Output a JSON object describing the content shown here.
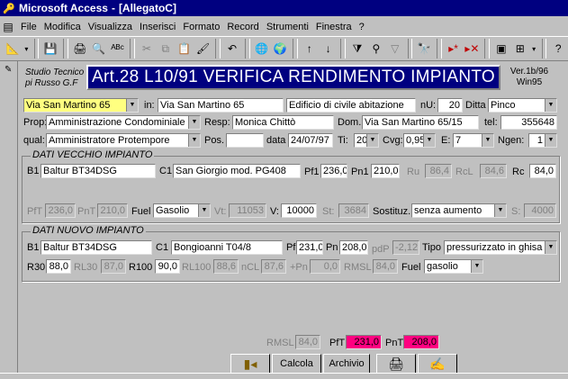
{
  "title": {
    "app": "Microsoft Access",
    "doc": "[AllegatoC]"
  },
  "menu": [
    "File",
    "Modifica",
    "Visualizza",
    "Inserisci",
    "Formato",
    "Record",
    "Strumenti",
    "Finestra",
    "?"
  ],
  "header": {
    "studio": "Studio Tecnico pi Russo G.F",
    "title": "Art.28 L10/91 VERIFICA RENDIMENTO IMPIANTO",
    "ver1": "Ver.1b/96",
    "ver2": "Win95"
  },
  "r1": {
    "address": "Via San Martino 65",
    "in_lbl": "in:",
    "in_val": "Via San Martino 65",
    "desc": "Edificio di civile abitazione",
    "nu_lbl": "nU:",
    "nu_val": "20",
    "ditta_lbl": "Ditta",
    "ditta_val": "Pinco"
  },
  "r2": {
    "prop_lbl": "Prop:",
    "prop_val": "Amministrazione Condominiale",
    "resp_lbl": "Resp:",
    "resp_val": "Monica Chittò",
    "dom_lbl": "Dom.",
    "dom_val": "Via San Martino 65/15",
    "tel_lbl": "tel:",
    "tel_val": "355648"
  },
  "r3": {
    "qual_lbl": "qual:",
    "qual_val": "Amministratore Protempore",
    "pos_lbl": "Pos.",
    "pos_val": "",
    "data_lbl": "data",
    "data_val": "24/07/97",
    "ti_lbl": "Ti:",
    "ti_val": "20",
    "cvg_lbl": "Cvg:",
    "cvg_val": "0,95",
    "e_lbl": "E:",
    "e_val": "7",
    "ngen_lbl": "Ngen:",
    "ngen_val": "1"
  },
  "old": {
    "title": "DATI VECCHIO IMPIANTO",
    "b1_lbl": "B1",
    "b1": "Baltur BT34DSG",
    "c1_lbl": "C1",
    "c1": "San Giorgio mod. PG408",
    "pf1_lbl": "Pf1",
    "pf1": "236,0",
    "pn1_lbl": "Pn1",
    "pn1": "210,0",
    "ru_lbl": "Ru",
    "ru": "86,4",
    "rcl_lbl": "RcL",
    "rcl": "84,6",
    "rc_lbl": "Rc",
    "rc": "84,0",
    "pft_lbl": "PfT",
    "pft": "236,0",
    "pnt_lbl": "PnT",
    "pnt": "210,0",
    "fuel_lbl": "Fuel",
    "fuel": "Gasolio",
    "vt_lbl": "Vt:",
    "vt": "11053",
    "v_lbl": "V:",
    "v": "10000",
    "st_lbl": "St:",
    "st": "3684",
    "sost_lbl": "Sostituz.",
    "sost": "senza aumento",
    "s_lbl": "S:",
    "s": "4000"
  },
  "new": {
    "title": "DATI NUOVO IMPIANTO",
    "b1_lbl": "B1",
    "b1": "Baltur BT34DSG",
    "c1_lbl": "C1",
    "c1": "Bongioanni T04/8",
    "pf_lbl": "Pf",
    "pf": "231,0",
    "pn_lbl": "Pn",
    "pn": "208,0",
    "pdp_lbl": "pdP",
    "pdp": "-2,12",
    "tipo_lbl": "Tipo",
    "tipo": "pressurizzato in ghisa",
    "r30_lbl": "R30",
    "r30": "88,0",
    "rl30_lbl": "RL30",
    "rl30": "87,0",
    "r100_lbl": "R100",
    "r100": "90,0",
    "rl100_lbl": "RL100",
    "rl100": "88,6",
    "ncl_lbl": "nCL",
    "ncl": "87,6",
    "pn2_lbl": "+Pn",
    "pn2": "0,0",
    "rmsl_lbl": "RMSL",
    "rmsl": "84,0",
    "fuel_lbl": "Fuel",
    "fuel": "gasolio"
  },
  "bottom": {
    "rmsl_lbl": "RMSL",
    "rmsl": "84,0",
    "pft_lbl": "PfT",
    "pft": "231,0",
    "pnt_lbl": "PnT",
    "pnt": "208,0"
  },
  "buttons": {
    "calcola": "Calcola",
    "archivio": "Archivio"
  }
}
